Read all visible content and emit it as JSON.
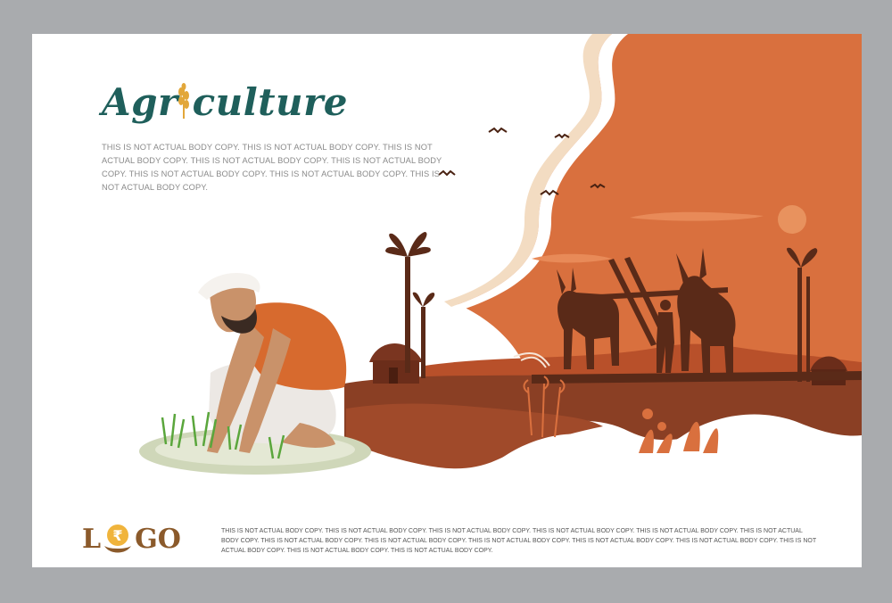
{
  "title": {
    "text_before": "Agr",
    "text_after": "culture",
    "color": "#1f5f5b",
    "wheat_icon_color": "#e2a73a"
  },
  "body_top": "THIS IS NOT ACTUAL BODY COPY. THIS IS NOT ACTUAL BODY COPY. THIS IS NOT ACTUAL BODY COPY. THIS IS NOT ACTUAL BODY COPY. THIS IS NOT ACTUAL BODY COPY. THIS IS NOT ACTUAL BODY COPY. THIS IS NOT ACTUAL BODY COPY. THIS IS NOT ACTUAL BODY COPY.",
  "logo": {
    "letter_l": "L",
    "letters_go": "GO",
    "currency_symbol": "₹",
    "color": "#8b5a2b",
    "coin_color": "#f0b43c"
  },
  "body_bottom": "THIS IS NOT ACTUAL BODY COPY. THIS IS NOT ACTUAL BODY COPY. THIS IS NOT ACTUAL BODY COPY. THIS IS NOT ACTUAL BODY COPY. THIS IS NOT ACTUAL BODY COPY. THIS IS NOT ACTUAL BODY COPY. THIS IS NOT ACTUAL BODY COPY. THIS IS NOT ACTUAL BODY COPY. THIS IS NOT ACTUAL BODY COPY. THIS IS NOT ACTUAL BODY COPY. THIS IS NOT ACTUAL BODY COPY. THIS IS NOT ACTUAL BODY COPY. THIS IS NOT ACTUAL BODY COPY. THIS IS NOT ACTUAL BODY COPY.",
  "colors": {
    "frame": "#a9abae",
    "sky": "#d9703e",
    "wave": "#f3dcc2",
    "soil": "#8a3f24",
    "silhouette": "#5a2a18"
  }
}
